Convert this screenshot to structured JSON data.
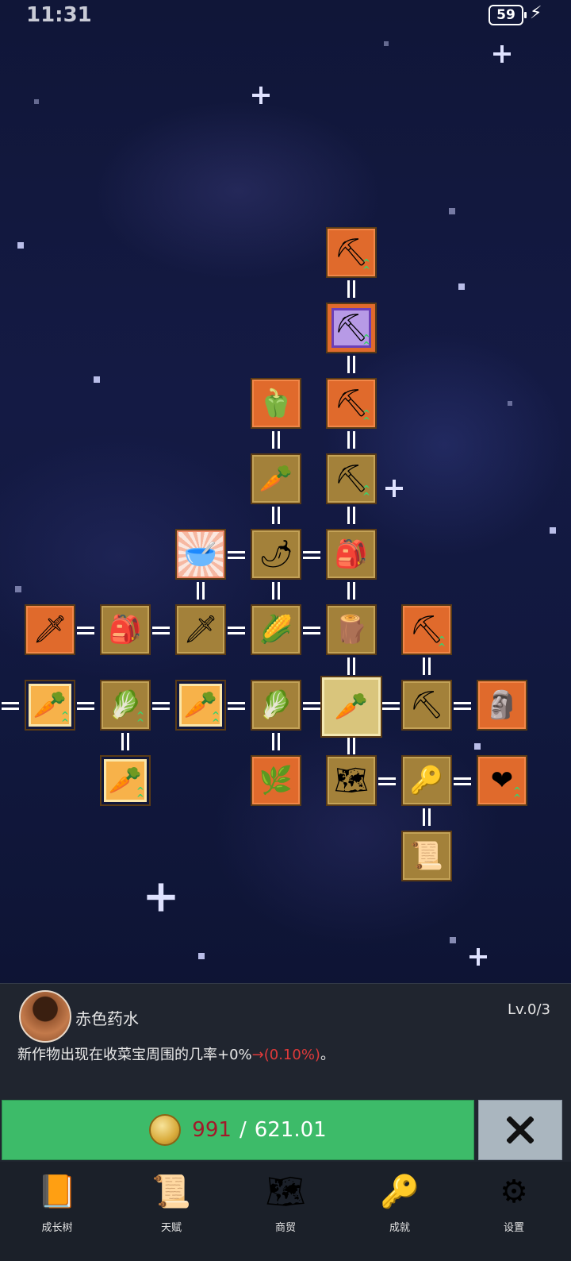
{
  "status_bar": {
    "time": "11:31",
    "battery": "59"
  },
  "tree": {
    "nodes": [
      {
        "id": "shovel-upgrade-top",
        "icon": "shovel-icon",
        "style": "orange",
        "up": true
      },
      {
        "id": "magic-shovel",
        "icon": "shovel-icon",
        "style": "purple",
        "up": true
      },
      {
        "id": "shovel-upgrade-2",
        "icon": "shovel-icon",
        "style": "orange",
        "up": true
      },
      {
        "id": "green-pepper",
        "icon": "pepper-icon",
        "style": "orange",
        "up": false
      },
      {
        "id": "shovel-basic",
        "icon": "shovel-icon",
        "style": "gold",
        "up": true
      },
      {
        "id": "white-radish",
        "icon": "radish-icon",
        "style": "gold",
        "up": false
      },
      {
        "id": "red-potion-bowl",
        "icon": "bowl-icon",
        "style": "glow",
        "up": false
      },
      {
        "id": "red-chili",
        "icon": "chili-icon",
        "style": "gold",
        "up": false
      },
      {
        "id": "backpack-upper",
        "icon": "backpack-icon",
        "style": "gold",
        "up": false
      },
      {
        "id": "sword-orange",
        "icon": "sword-icon",
        "style": "orange",
        "up": false
      },
      {
        "id": "backpack-left",
        "icon": "backpack-icon",
        "style": "gold",
        "up": false
      },
      {
        "id": "sword-gold",
        "icon": "sword-icon",
        "style": "gold",
        "up": false
      },
      {
        "id": "corn",
        "icon": "corn-icon",
        "style": "gold",
        "up": false
      },
      {
        "id": "wooden-stick",
        "icon": "stick-icon",
        "style": "gold",
        "up": false
      },
      {
        "id": "pickaxe-orange",
        "icon": "pickaxe-icon",
        "style": "orange",
        "up": true
      },
      {
        "id": "carrot-framed-left",
        "icon": "carrot-icon",
        "style": "framed",
        "up": true
      },
      {
        "id": "cabbage-left",
        "icon": "cabbage-icon",
        "style": "gold",
        "up": true
      },
      {
        "id": "carrot-framed-mid",
        "icon": "carrot-icon",
        "style": "framed",
        "up": true
      },
      {
        "id": "cabbage-mid",
        "icon": "cabbage-icon",
        "style": "gold",
        "up": false
      },
      {
        "id": "carrot-center",
        "icon": "carrot-icon",
        "style": "sel",
        "up": false
      },
      {
        "id": "pickaxe-gold",
        "icon": "pickaxe-icon",
        "style": "gold",
        "up": false
      },
      {
        "id": "stone-statue",
        "icon": "statue-icon",
        "style": "orange",
        "up": false
      },
      {
        "id": "carrot-framed-bottom",
        "icon": "carrot-icon",
        "style": "framed",
        "up": true
      },
      {
        "id": "leek",
        "icon": "leek-icon",
        "style": "orange",
        "up": false
      },
      {
        "id": "map",
        "icon": "map-icon",
        "style": "gold",
        "up": false
      },
      {
        "id": "golden-key",
        "icon": "key-icon",
        "style": "gold",
        "up": false
      },
      {
        "id": "heart",
        "icon": "heart-icon",
        "style": "orange",
        "up": true
      },
      {
        "id": "scroll",
        "icon": "scroll-icon",
        "style": "gold",
        "up": false
      }
    ]
  },
  "detail": {
    "icon": "bowl-icon",
    "name": "赤色药水",
    "level": "Lv.0/3",
    "desc_main": "新作物出现在收菜宝周围的几率+0%",
    "desc_arrow": "→(0.10%)",
    "desc_end": "。"
  },
  "upgrade": {
    "coin_icon": "coin-icon",
    "current": "991",
    "separator": "/",
    "required": "621.01"
  },
  "close": {
    "icon": "close-x-icon"
  },
  "nav": [
    {
      "label": "成长树",
      "icon": "book-icon"
    },
    {
      "label": "天赋",
      "icon": "scroll-icon"
    },
    {
      "label": "商贸",
      "icon": "map-icon"
    },
    {
      "label": "成就",
      "icon": "key-icon"
    },
    {
      "label": "设置",
      "icon": "gear-icon"
    }
  ],
  "colors": {
    "accent_green": "#3dbb69",
    "cost_red": "#a3192a",
    "desc_red": "#e03a3a"
  }
}
